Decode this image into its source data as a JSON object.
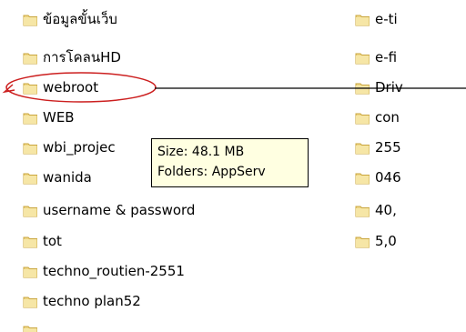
{
  "left_items": [
    {
      "label": "ข้อมูลขั้นเว็บ"
    },
    {
      "label": "การโคลนHD"
    },
    {
      "label": "webroot"
    },
    {
      "label": "WEB"
    },
    {
      "label": "wbi_projec"
    },
    {
      "label": "wanida"
    },
    {
      "label": "username & password"
    },
    {
      "label": "tot"
    },
    {
      "label": "techno_routien-2551"
    },
    {
      "label": "techno plan52"
    },
    {
      "label": ""
    }
  ],
  "right_items": [
    {
      "label": "e-ti"
    },
    {
      "label": "e-fi"
    },
    {
      "label": "Driv"
    },
    {
      "label": "con"
    },
    {
      "label": "255"
    },
    {
      "label": "046"
    },
    {
      "label": "40,"
    },
    {
      "label": "5,0"
    }
  ],
  "tooltip": {
    "size_line": "Size: 48.1 MB",
    "folders_line": "Folders: AppServ"
  },
  "colors": {
    "folder_body": "#f0d889",
    "folder_shadow": "#c9a53c",
    "annotation_circle": "#cc1f1f",
    "tooltip_bg": "#ffffe1"
  },
  "icons": {
    "folder": "folder-icon"
  }
}
